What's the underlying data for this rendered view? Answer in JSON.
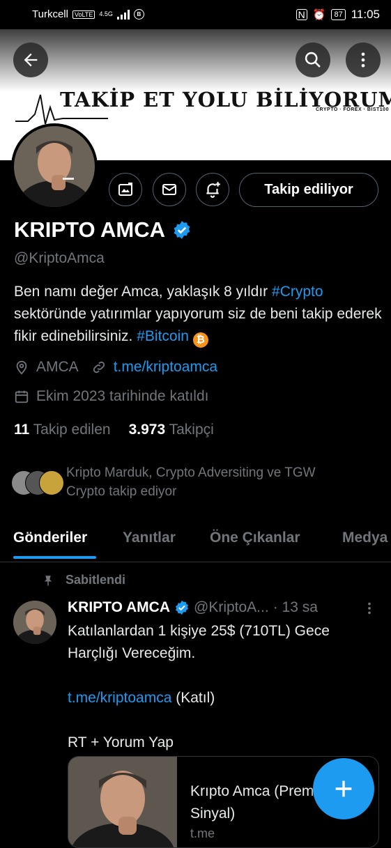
{
  "status_bar": {
    "carrier": "Turkcell",
    "volte": "VoLTE",
    "network": "4.5G",
    "battery": "87",
    "time": "11:05"
  },
  "banner": {
    "title": "TAKİP ET YOLU BİLİYORUM",
    "subtitle": "CRYPTO · FOREX · BIST100"
  },
  "profile": {
    "name": "KRIPTO AMCA",
    "handle": "@KriptoAmca",
    "follow_button": "Takip ediliyor",
    "bio_text": "Ben namı değer Amca, yaklaşık 8 yıldır ",
    "bio_hashtag1": "#Crypto",
    "bio_text2": " sektöründe yatırımlar yapıyorum siz de beni takip ederek fikir edinebilirsiniz. ",
    "bio_hashtag2": "#Bitcoin",
    "bio_emoji": "₿",
    "location": "AMCA",
    "website": "t.me/kriptoamca",
    "joined": "Ekim 2023 tarihinde katıldı",
    "following_count": "11",
    "following_label": "Takip edilen",
    "followers_count": "3.973",
    "followers_label": "Takipçi",
    "followed_by_line1": "Kripto Marduk, Crypto Adversiting ve TGW",
    "followed_by_line2": "Crypto takip ediyor"
  },
  "tabs": [
    "Gönderiler",
    "Yanıtlar",
    "Öne Çıkanlar",
    "Medya"
  ],
  "pinned_tweet": {
    "pinned_label": "Sabitlendi",
    "name": "KRIPTO AMCA",
    "handle": "@KriptoA...",
    "time": "· 13 sa",
    "line1": "Katılanlardan 1 kişiye 25$ (710TL) Gece Harçlığı Vereceğim.",
    "link": "t.me/kriptoamca",
    "link_suffix": " (Katıl)",
    "line3": "RT + Yorum Yap",
    "card_title": "Krıpto Amca (Premium Sinyal)",
    "card_domain": "t.me"
  },
  "icons": [
    "back-arrow-icon",
    "search-icon",
    "more-vertical-icon",
    "grok-image-icon",
    "mail-icon",
    "notification-bell-plus-icon",
    "verified-badge-icon",
    "location-icon",
    "link-icon",
    "calendar-icon",
    "pin-icon",
    "plus-icon"
  ],
  "colors": {
    "accent": "#1d9bf0",
    "muted": "#71767b",
    "bitcoin": "#f7931a"
  }
}
